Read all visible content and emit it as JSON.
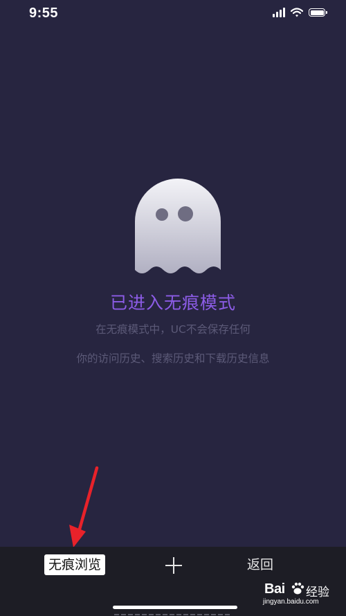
{
  "status_bar": {
    "time": "9:55",
    "icons": [
      "signal-icon",
      "wifi-icon",
      "battery-icon"
    ]
  },
  "main": {
    "illustration": "ghost-icon",
    "title": "已进入无痕模式",
    "description_line1": "在无痕模式中，UC不会保存任何",
    "description_line2": "你的访问历史、搜索历史和下载历史信息"
  },
  "toolbar": {
    "incognito_label": "无痕浏览",
    "new_tab_icon": "plus-icon",
    "back_label": "返回"
  },
  "watermark": {
    "logo_text": "Bai",
    "brand_text": "经验",
    "url": "jingyan.baidu.com"
  },
  "colors": {
    "background": "#272540",
    "title": "#8c5ce6",
    "description": "#5c5a78",
    "toolbar": "#1d1d25",
    "arrow": "#e8222a"
  }
}
